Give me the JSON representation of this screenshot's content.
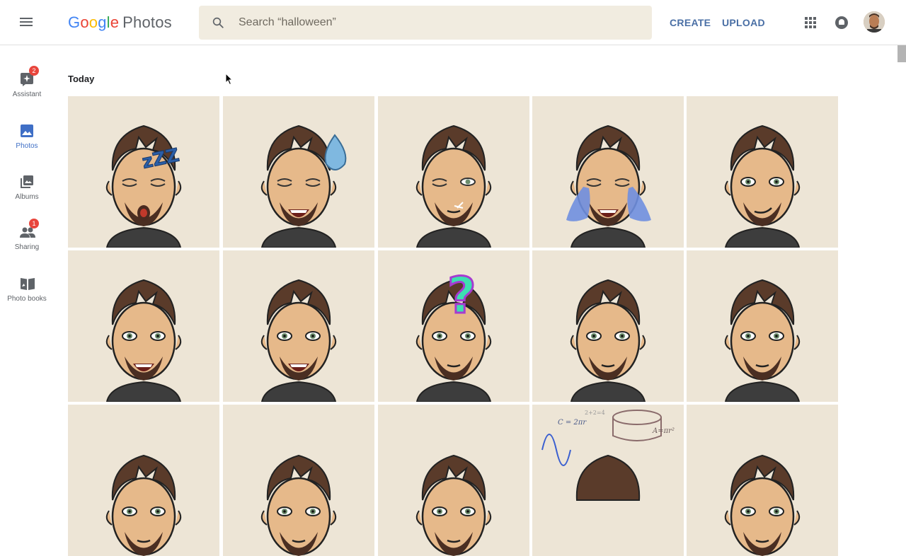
{
  "header": {
    "menu_icon": "hamburger-menu-icon",
    "logo": {
      "letters": [
        "G",
        "o",
        "o",
        "g",
        "l",
        "e"
      ],
      "product": "Photos"
    },
    "search": {
      "placeholder": "Search “halloween”",
      "value": ""
    },
    "create_label": "CREATE",
    "upload_label": "UPLOAD"
  },
  "sidebar": {
    "items": [
      {
        "label": "Assistant",
        "icon": "assistant-icon",
        "badge": "2"
      },
      {
        "label": "Photos",
        "icon": "photo-icon",
        "badge": ""
      },
      {
        "label": "Albums",
        "icon": "albums-icon",
        "badge": ""
      },
      {
        "label": "Sharing",
        "icon": "people-icon",
        "badge": "1"
      },
      {
        "label": "Photo books",
        "icon": "book-icon",
        "badge": ""
      }
    ]
  },
  "main": {
    "section_title": "Today",
    "tiles": [
      {
        "expression": "sleeping",
        "decoration": "zzz"
      },
      {
        "expression": "laughing",
        "decoration": "sweat-drop"
      },
      {
        "expression": "winking",
        "decoration": "sparkle"
      },
      {
        "expression": "crying",
        "decoration": "tears"
      },
      {
        "expression": "smirk",
        "decoration": ""
      },
      {
        "expression": "laughing-open",
        "decoration": ""
      },
      {
        "expression": "grinning",
        "decoration": ""
      },
      {
        "expression": "confused",
        "decoration": "question-mark"
      },
      {
        "expression": "neutral",
        "decoration": ""
      },
      {
        "expression": "neutral",
        "decoration": ""
      },
      {
        "expression": "partial",
        "decoration": ""
      },
      {
        "expression": "partial",
        "decoration": ""
      },
      {
        "expression": "partial",
        "decoration": ""
      },
      {
        "expression": "math",
        "decoration": "formulas"
      },
      {
        "expression": "partial",
        "decoration": ""
      }
    ]
  },
  "colors": {
    "accent": "#4a6fa5",
    "tile_bg": "#ede5d6",
    "search_bg": "#f1ece0",
    "badge": "#e8453c"
  }
}
